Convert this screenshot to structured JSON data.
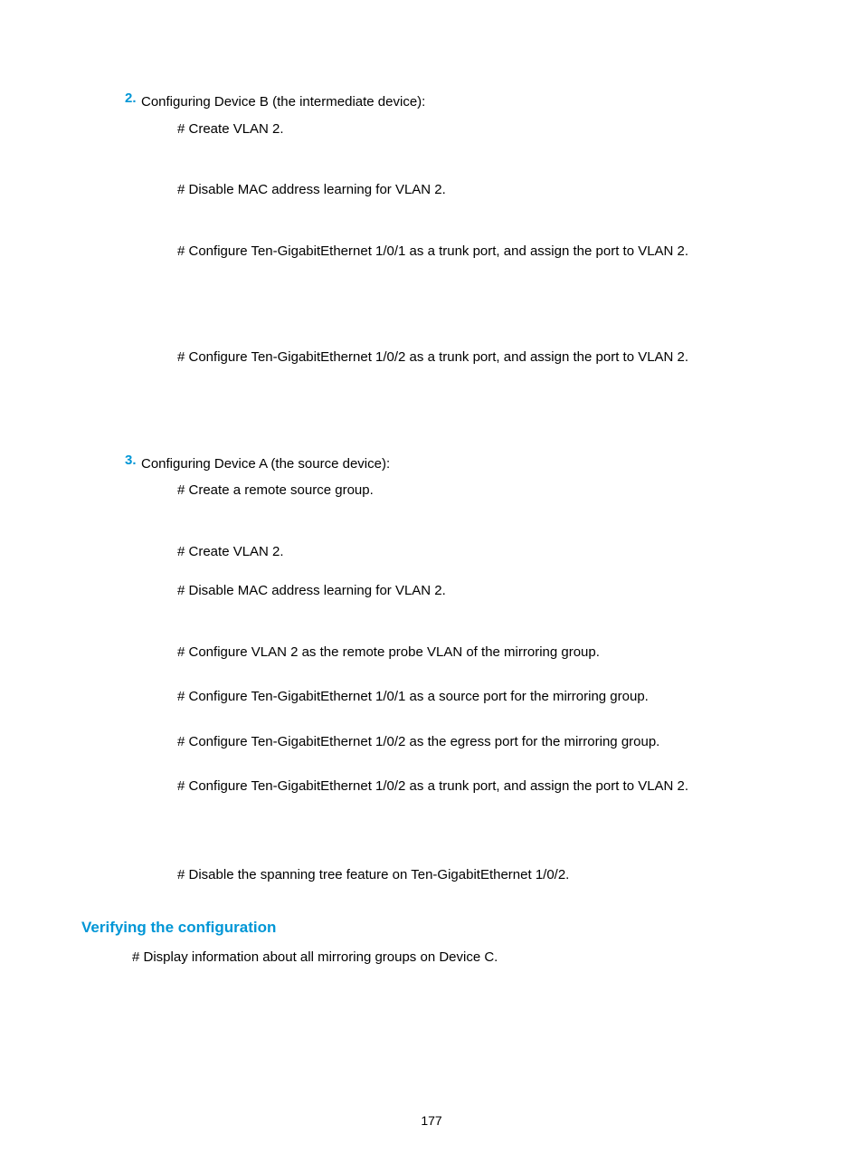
{
  "step2": {
    "num": "2.",
    "title": "Configuring Device B (the intermediate device):",
    "lines": [
      "# Create VLAN 2.",
      "# Disable MAC address learning for VLAN 2.",
      "# Configure Ten-GigabitEthernet 1/0/1 as a trunk port, and assign the port to VLAN 2.",
      "# Configure Ten-GigabitEthernet 1/0/2 as a trunk port, and assign the port to VLAN 2."
    ]
  },
  "step3": {
    "num": "3.",
    "title": "Configuring Device A (the source device):",
    "lines": [
      "# Create a remote source group.",
      "# Create VLAN 2.",
      "# Disable MAC address learning for VLAN 2.",
      "# Configure VLAN 2 as the remote probe VLAN of the mirroring group.",
      "# Configure Ten-GigabitEthernet 1/0/1 as a source port for the mirroring group.",
      "# Configure Ten-GigabitEthernet 1/0/2 as the egress port for the mirroring group.",
      "# Configure Ten-GigabitEthernet 1/0/2 as a trunk port, and assign the port to VLAN 2.",
      "# Disable the spanning tree feature on Ten-GigabitEthernet 1/0/2."
    ]
  },
  "verify": {
    "heading": "Verifying the configuration",
    "line": "# Display information about all mirroring groups on Device C."
  },
  "pageNumber": "177"
}
